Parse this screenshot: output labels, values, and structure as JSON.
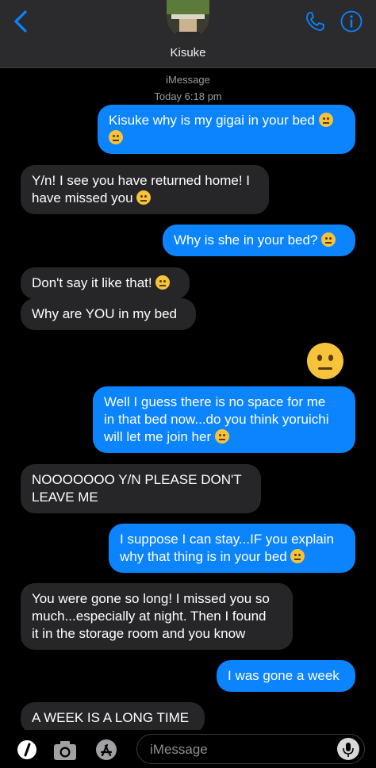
{
  "header": {
    "contact_name": "Kisuke",
    "back_icon": "chevron-left-icon",
    "call_icon": "phone-icon",
    "info_icon": "info-icon"
  },
  "meta": {
    "service": "iMessage",
    "timestamp": "Today 6:18 pm"
  },
  "messages": [
    {
      "dir": "out",
      "lines": [
        "Kisuke why is my gigai in your bed",
        ""
      ]
    },
    {
      "dir": "in",
      "lines": [
        "Y/n! I see you have returned home! I",
        "have missed you"
      ]
    },
    {
      "dir": "out",
      "lines": [
        "Why is she in your bed?"
      ]
    },
    {
      "dir": "in",
      "lines": [
        "Don't say it like that!"
      ]
    },
    {
      "dir": "in",
      "lines": [
        "Why are YOU in my bed"
      ]
    },
    {
      "dir": "out",
      "lines": [
        "Well I guess there is no space for me",
        "in that bed now...do you think yoruichi",
        "will let me join her"
      ]
    },
    {
      "dir": "in",
      "lines": [
        "NOOOOOOO Y/N PLEASE DON'T",
        "LEAVE ME"
      ]
    },
    {
      "dir": "out",
      "lines": [
        "I suppose I can stay...IF you explain",
        "why that thing is in your bed"
      ]
    },
    {
      "dir": "in",
      "lines": [
        "You were gone so long! I missed you so",
        "much...especially at night. Then I found",
        "it in the storage room and you know"
      ]
    },
    {
      "dir": "out",
      "lines": [
        "I was gone a week"
      ]
    },
    {
      "dir": "in",
      "lines": [
        "A WEEK IS A LONG TIME"
      ]
    }
  ],
  "composer": {
    "placeholder": "iMessage",
    "icons": [
      "digital-touch-icon",
      "camera-icon",
      "app-store-icon",
      "microphone-icon"
    ]
  },
  "colors": {
    "outgoing": "#0b84fe",
    "incoming": "#262628",
    "accent": "#0a84ff"
  }
}
